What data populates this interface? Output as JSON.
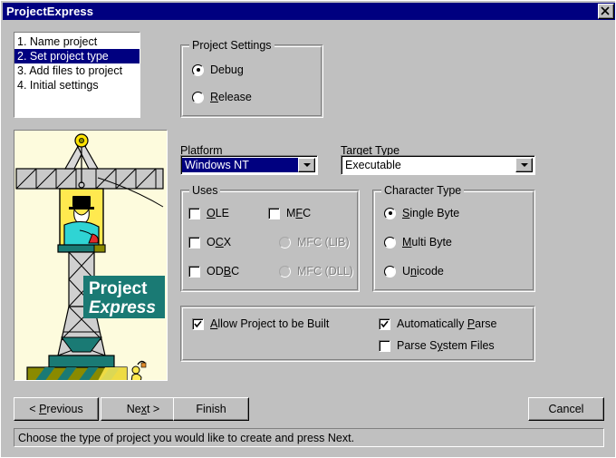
{
  "window": {
    "title": "ProjectExpress",
    "close_icon": "close-icon",
    "titlebar_color": "#000080",
    "face_color": "#c0c0c0"
  },
  "steps": {
    "items": [
      {
        "label": "1. Name project",
        "selected": false
      },
      {
        "label": "2. Set project type",
        "selected": true
      },
      {
        "label": "3. Add files to project",
        "selected": false
      },
      {
        "label": "4. Initial settings",
        "selected": false
      }
    ]
  },
  "illustration": {
    "logo_line1": "Project",
    "logo_line2": "Express",
    "logo_color": "#1a7a74",
    "background_color": "#fdfbdd"
  },
  "project_settings": {
    "legend": "Project Settings",
    "options": [
      {
        "label": "Debug",
        "accel": "g",
        "checked": true
      },
      {
        "label": "Release",
        "accel": "R",
        "checked": false
      }
    ]
  },
  "platform": {
    "label": "Platform",
    "accel": "P",
    "value": "Windows NT",
    "focused": true
  },
  "target_type": {
    "label": "Target Type",
    "accel": "T",
    "value": "Executable",
    "focused": false
  },
  "uses": {
    "legend": "Uses",
    "checkboxes": [
      {
        "label": "OLE",
        "accel": "O",
        "checked": false,
        "disabled": false
      },
      {
        "label": "OCX",
        "accel": "C",
        "checked": false,
        "disabled": false
      },
      {
        "label": "ODBC",
        "accel": "B",
        "checked": false,
        "disabled": false
      },
      {
        "label": "MFC",
        "accel": "F",
        "checked": false,
        "disabled": false
      }
    ],
    "radios": [
      {
        "label": "MFC (LIB)",
        "checked": false,
        "disabled": true
      },
      {
        "label": "MFC (DLL)",
        "checked": false,
        "disabled": true
      }
    ]
  },
  "character_type": {
    "legend": "Character Type",
    "options": [
      {
        "label": "Single Byte",
        "accel": "S",
        "checked": true
      },
      {
        "label": "Multi Byte",
        "accel": "M",
        "checked": false
      },
      {
        "label": "Unicode",
        "accel": "n",
        "checked": false
      }
    ]
  },
  "build_options": {
    "allow_build": {
      "label": "Allow Project to be Built",
      "accel": "A",
      "checked": true
    },
    "auto_parse": {
      "label": "Automatically Parse",
      "accel": "P",
      "checked": true
    },
    "parse_system": {
      "label": "Parse System Files",
      "accel": "y",
      "checked": false
    }
  },
  "buttons": {
    "previous": "< Previous",
    "next": "Next >",
    "finish": "Finish",
    "cancel": "Cancel"
  },
  "statusbar": {
    "text": "Choose the type of project you would like to create and press Next."
  }
}
